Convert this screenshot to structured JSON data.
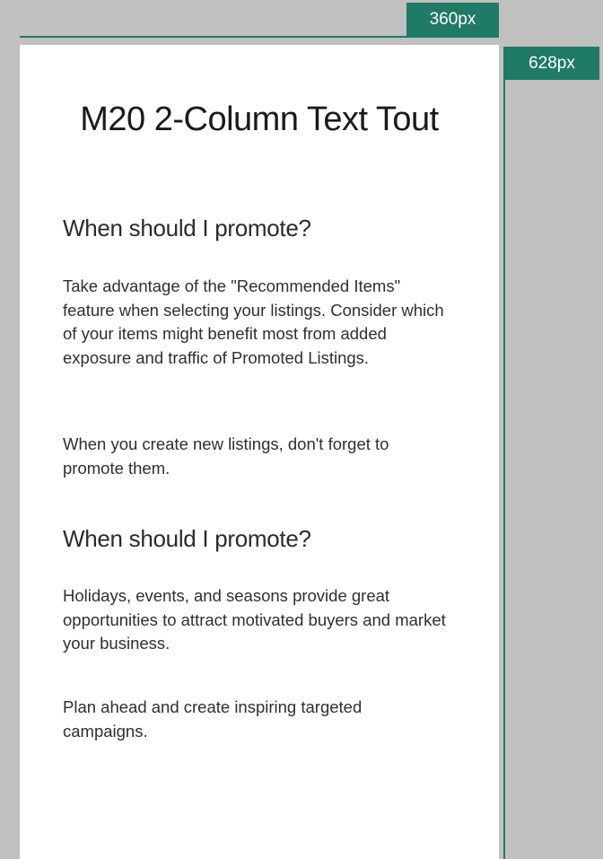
{
  "annotations": {
    "width_label": "360px",
    "height_label": "628px",
    "accent_color": "#1f7a66"
  },
  "module": {
    "title": "M20 2-Column Text Tout",
    "sections": [
      {
        "heading": "When should I promote?",
        "paragraphs": [
          "Take advantage of the \"Recommended Items\" feature when selecting your listings. Consider which of your items might benefit most from added exposure and traffic of Promoted Listings.",
          "When you create new listings, don't forget to promote them."
        ]
      },
      {
        "heading": "When should I promote?",
        "paragraphs": [
          "Holidays, events, and seasons provide great opportunities to attract motivated buyers and market your business.",
          "Plan ahead and create inspiring targeted campaigns."
        ]
      }
    ]
  }
}
